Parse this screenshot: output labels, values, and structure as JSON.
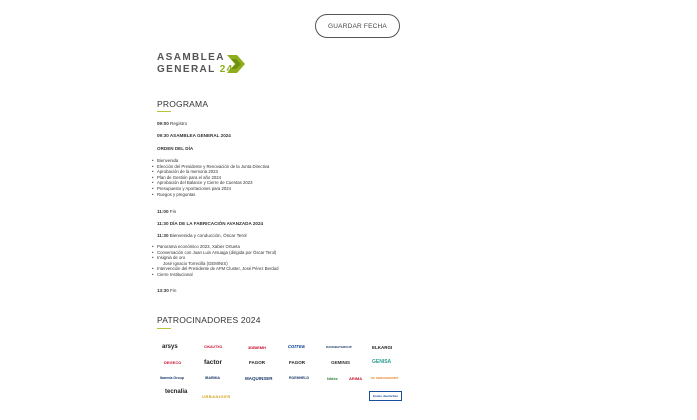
{
  "header": {
    "save_label": "GUARDAR FECHA"
  },
  "logo": {
    "line1": "ASAMBLEA",
    "line2": "GENERAL",
    "year": "24"
  },
  "programa": {
    "title": "PROGRAMA",
    "registro_time": "09:00",
    "registro_text": "Registro",
    "asamblea": "09:30 ASAMBLEA GENERAL 2024",
    "orden_title": "ORDEN DEL DÍA",
    "orden_items": [
      "Bienvenida",
      "Elección del Presidente y Renovación de la Junta Directiva",
      "Aprobación de la memoria 2023",
      "Plan de Gestión para el año 2024",
      "Aprobación del Balance y Cierre de Cuentas 2023",
      "Presupuesto y Aportaciones para 2024",
      "Ruegos y preguntas"
    ],
    "fin1_time": "11:00",
    "fin1_text": "Fin",
    "jornada": "11:30 DÍA DE LA FABRICACIÓN AVANZADA 2024",
    "bienvenida_time": "11:30",
    "bienvenida_text": "Bienvenida y conducción, Óscar Terol",
    "jornada_items": [
      "Panorama económico 2023, Xabier Ortueta",
      "Conversación con Juan Luis Arsuaga (dirigida por Óscar Terol)",
      "Insignia de oro"
    ],
    "jornada_sub": "José Ignacio Torrecilla (GEMINIS)",
    "jornada_items2": [
      "Intervención del Presidente de AFM Cluster, José Pérez Berdud",
      "Cierre Institucional"
    ],
    "fin2_time": "13:30",
    "fin2_text": "Fin"
  },
  "patrocinadores": {
    "title": "PATROCINADORES 2024",
    "sponsors": [
      {
        "name": "arsys",
        "color": "#222222"
      },
      {
        "name": "CIKAUTXO",
        "color": "#c8102e"
      },
      {
        "name": "3DBIEMH",
        "color": "#c8102e"
      },
      {
        "name": "correa",
        "color": "#1b4f9c"
      },
      {
        "name": "DANOBATGROUP",
        "color": "#1b3a6b"
      },
      {
        "name": "ELKARGI",
        "color": "#222222"
      },
      {
        "name": "DEGECO",
        "color": "#c8102e"
      },
      {
        "name": "factor",
        "color": "#222222"
      },
      {
        "name": "FAGOR",
        "color": "#222222"
      },
      {
        "name": "FAGOR",
        "color": "#222222"
      },
      {
        "name": "GEMINIS",
        "color": "#333333"
      },
      {
        "name": "GENISA",
        "color": "#2a9d8f"
      },
      {
        "name": "Ibarmia Group",
        "color": "#1b3a6b"
      },
      {
        "name": "IBARMIA",
        "color": "#1b3a6b"
      },
      {
        "name": "MAQUINSER",
        "color": "#1b3a6b"
      },
      {
        "name": "ROEMHELD",
        "color": "#1b3a6b"
      },
      {
        "name": "Nidec",
        "color": "#2e7d32"
      },
      {
        "name": "ARIMA",
        "color": "#c8102e"
      },
      {
        "name": "SC SERVICEPOINT",
        "color": "#e67e22"
      },
      {
        "name": "tecnalia",
        "color": "#222222"
      },
      {
        "name": "URBANIGER",
        "color": "#d4a017"
      },
      {
        "name": "Eusko Jaurlaritza",
        "color": "#1b4f9c"
      }
    ]
  }
}
